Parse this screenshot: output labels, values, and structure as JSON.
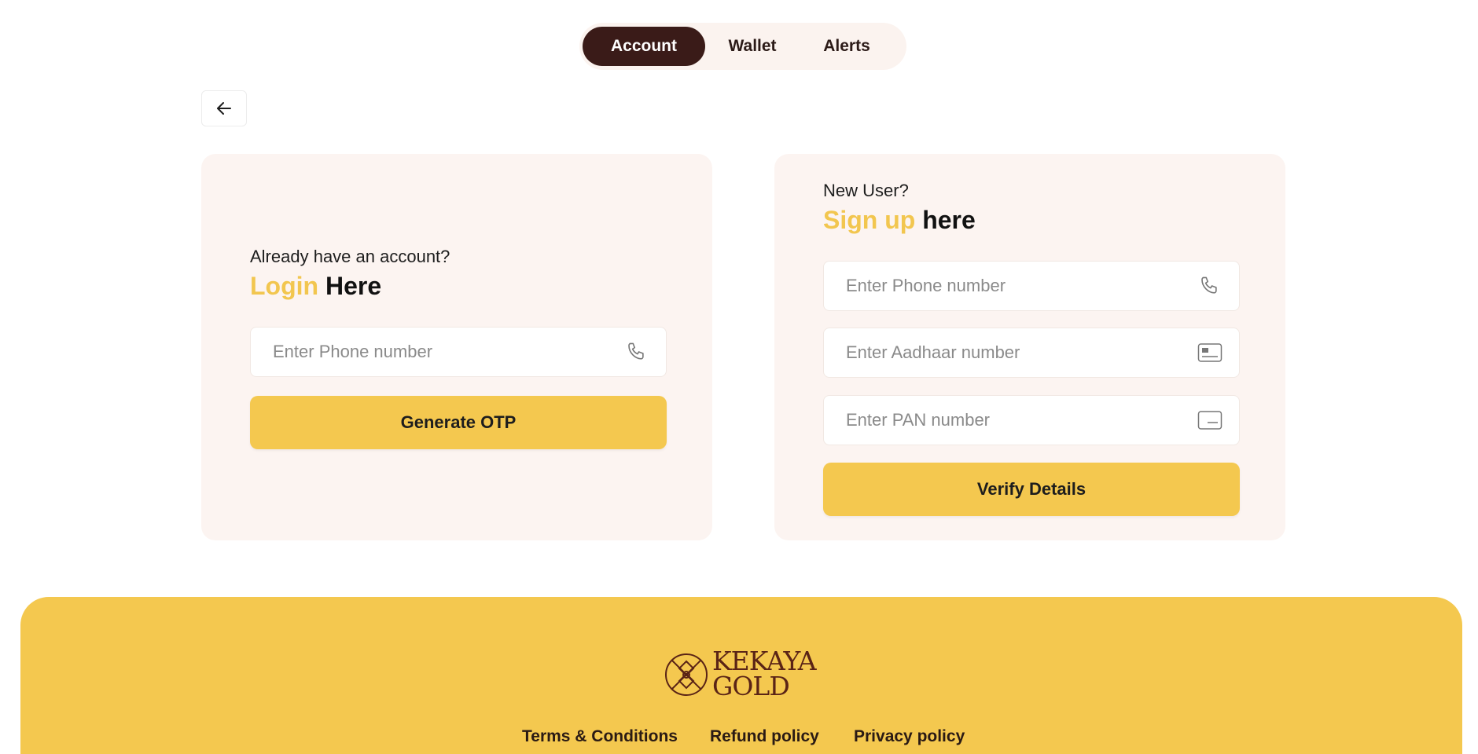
{
  "nav": {
    "tabs": [
      {
        "label": "Account",
        "active": true
      },
      {
        "label": "Wallet",
        "active": false
      },
      {
        "label": "Alerts",
        "active": false
      }
    ],
    "back_icon": "arrow-left-icon"
  },
  "login": {
    "eyebrow": "Already have an account?",
    "heading_accent": "Login",
    "heading_rest": "Here",
    "phone_placeholder": "Enter Phone number",
    "phone_icon": "phone-icon",
    "submit_label": "Generate OTP"
  },
  "signup": {
    "eyebrow": "New User?",
    "heading_accent": "Sign up",
    "heading_rest": "here",
    "phone_placeholder": "Enter Phone number",
    "aadhaar_placeholder": "Enter Aadhaar number",
    "pan_placeholder": "Enter PAN number",
    "phone_icon": "phone-icon",
    "aadhaar_icon": "id-card-icon",
    "pan_icon": "card-icon",
    "submit_label": "Verify Details"
  },
  "footer": {
    "brand_line1": "KEKAYA",
    "brand_line2": "GOLD",
    "links": [
      "Terms & Conditions",
      "Refund policy",
      "Privacy policy"
    ]
  },
  "colors": {
    "accent": "#f4c84f",
    "active_tab": "#3a1b18",
    "card_bg": "#fcf4f1",
    "brand": "#5a2416"
  }
}
